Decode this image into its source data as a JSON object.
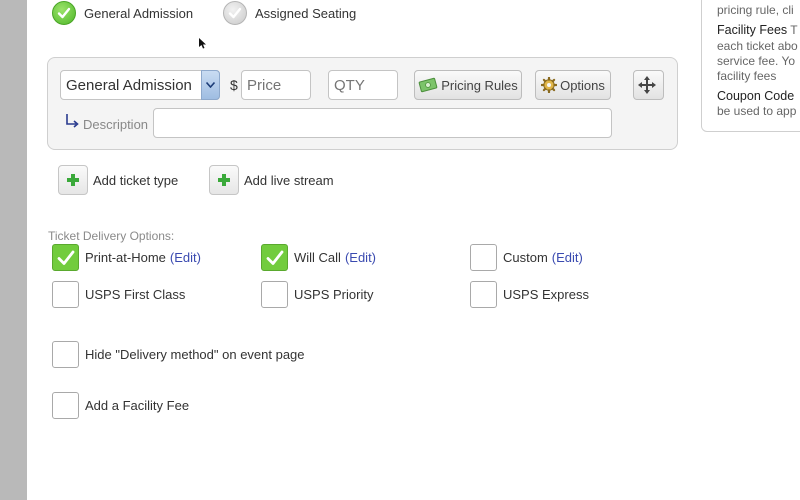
{
  "seating": {
    "general_admission": "General Admission",
    "assigned_seating": "Assigned Seating"
  },
  "ticket": {
    "type_selected": "General Admission",
    "currency_symbol": "$",
    "price_placeholder": "Price",
    "qty_placeholder": "QTY",
    "pricing_rules_label": "Pricing Rules",
    "options_label": "Options",
    "description_label": "Description",
    "description_value": ""
  },
  "actions": {
    "add_ticket_type": "Add ticket type",
    "add_live_stream": "Add live stream"
  },
  "delivery": {
    "section_label": "Ticket Delivery Options:",
    "edit_label": "(Edit)",
    "options": [
      {
        "label": "Print-at-Home",
        "checked": true,
        "editable": true
      },
      {
        "label": "Will Call",
        "checked": true,
        "editable": true
      },
      {
        "label": "Custom",
        "checked": false,
        "editable": true
      },
      {
        "label": "USPS First Class",
        "checked": false,
        "editable": false
      },
      {
        "label": "USPS Priority",
        "checked": false,
        "editable": false
      },
      {
        "label": "USPS Express",
        "checked": false,
        "editable": false
      }
    ],
    "hide_delivery_method": "Hide \"Delivery method\" on event page",
    "add_facility_fee": "Add a Facility Fee"
  },
  "info_panel": {
    "line1": "pricing rule, cli",
    "facility_fees_head": "Facility Fees",
    "facility_fees_head_tail": " T",
    "line3": "each ticket abo",
    "line4": "service fee. Yo",
    "line5": "facility fees",
    "coupon_head": "Coupon Code",
    "line7": "be used to app"
  },
  "colors": {
    "check_green": "#72cc3d",
    "link_blue": "#3a4ab0",
    "gutter_gray": "#b9b9b9"
  }
}
